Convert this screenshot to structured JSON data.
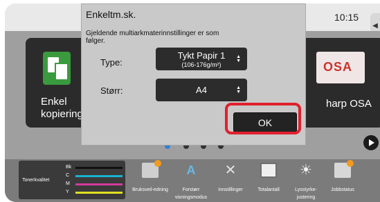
{
  "status_bar": {
    "time": "10:15"
  },
  "home": {
    "tiles": [
      {
        "label_line1": "Enkel",
        "label_line2": "kopiering",
        "icon": "copy-icon"
      },
      {
        "label": "harp OSA",
        "icon": "osa-logo",
        "logo_text": "OSA"
      }
    ],
    "page_dots": 4,
    "active_dot": 0
  },
  "dialog": {
    "title": "Enkeltm.sk.",
    "message": "Gjeldende multiarkmaterinnstillinger er som følger.",
    "type_label": "Type:",
    "type_value": "Tykt Papir 1",
    "type_sub": "(106-176g/m²)",
    "size_label": "Størr:",
    "size_value": "A4",
    "ok_label": "OK"
  },
  "toner": {
    "title": "Tonerkvalitet",
    "rows": [
      {
        "label": "Bk",
        "color": "#111111"
      },
      {
        "label": "C",
        "color": "#19b2d1"
      },
      {
        "label": "M",
        "color": "#d23b9a"
      },
      {
        "label": "Y",
        "color": "#e0e020"
      }
    ]
  },
  "toolbar": {
    "items": [
      {
        "label": "Bruksveil-edning",
        "icon": "manual-icon"
      },
      {
        "label": "Forstørr visningsmodus",
        "icon": "zoom-icon"
      },
      {
        "label": "Innstillinger",
        "icon": "settings-icon"
      },
      {
        "label": "Totalantall",
        "icon": "counter-icon"
      },
      {
        "label": "Lysstyrke-justering",
        "icon": "brightness-icon"
      },
      {
        "label": "Jobbstatus",
        "icon": "job-status-icon"
      }
    ]
  },
  "colors": {
    "highlight": "#e0202e",
    "active_dot": "#2e7fd8"
  }
}
